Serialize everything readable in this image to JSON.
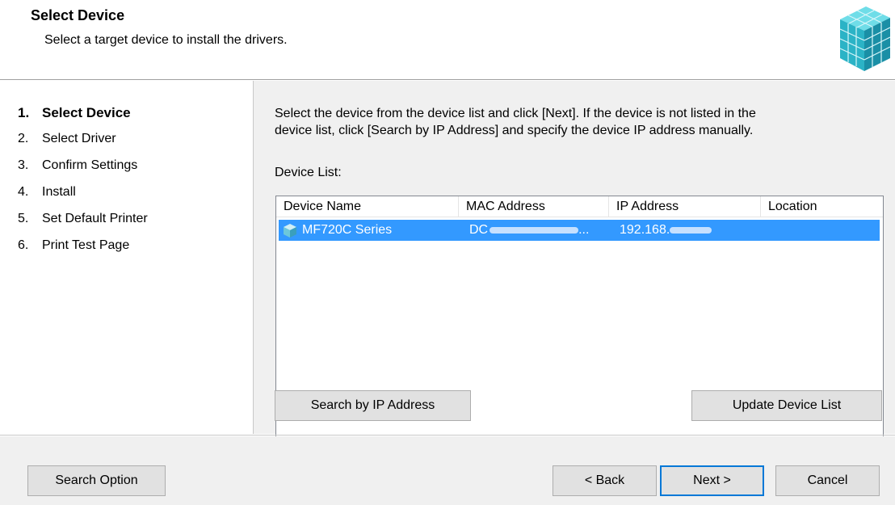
{
  "header": {
    "title": "Select Device",
    "subtitle": "Select a target device to install the drivers."
  },
  "steps": [
    {
      "num": "1.",
      "label": "Select Device",
      "active": true
    },
    {
      "num": "2.",
      "label": "Select Driver"
    },
    {
      "num": "3.",
      "label": "Confirm Settings"
    },
    {
      "num": "4.",
      "label": "Install"
    },
    {
      "num": "5.",
      "label": "Set Default Printer"
    },
    {
      "num": "6.",
      "label": "Print Test Page"
    }
  ],
  "main": {
    "instructions_line1": "Select the device from the device list and click [Next]. If the device is not listed in the",
    "instructions_line2": "device list, click [Search by IP Address] and specify the device IP address manually.",
    "list_label": "Device List:"
  },
  "device_list": {
    "columns": [
      "Device Name",
      "MAC Address",
      "IP Address",
      "Location"
    ],
    "rows": [
      {
        "device_name": "MF720C Series",
        "mac_prefix": "DC",
        "mac_suffix": "...",
        "ip_prefix": "192.168.",
        "location": "",
        "selected": true
      }
    ]
  },
  "buttons": {
    "search_ip": "Search by IP Address",
    "update_list": "Update Device List",
    "search_option": "Search Option",
    "back": "< Back",
    "next": "Next >",
    "cancel": "Cancel"
  },
  "colors": {
    "selection": "#3399ff",
    "dialog_bg": "#f0f0f0",
    "logo_teal": "#2fb6c8"
  },
  "icons": [
    "cube-logo-icon",
    "printer-device-icon"
  ]
}
